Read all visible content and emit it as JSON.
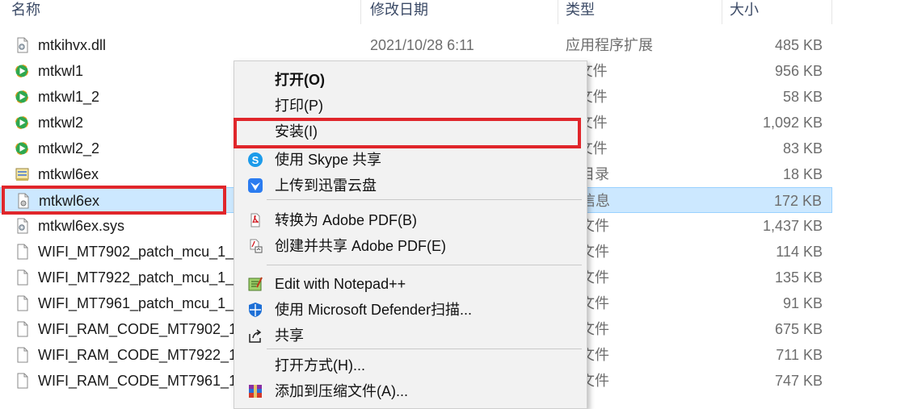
{
  "columns": {
    "name": "名称",
    "date": "修改日期",
    "type": "类型",
    "size": "大小"
  },
  "files": [
    {
      "name": "mtkihvx.dll",
      "date": "2021/10/28 6:11",
      "type": "应用程序扩展",
      "size": "485 KB",
      "icon": "dll-file-icon"
    },
    {
      "name": "mtkwl1",
      "date": "",
      "type": "T 文件",
      "size": "956 KB",
      "icon": "media-file-icon"
    },
    {
      "name": "mtkwl1_2",
      "date": "",
      "type": "T 文件",
      "size": "58 KB",
      "icon": "media-file-icon"
    },
    {
      "name": "mtkwl2",
      "date": "",
      "type": "T 文件",
      "size": "1,092 KB",
      "icon": "media-file-icon"
    },
    {
      "name": "mtkwl2_2",
      "date": "",
      "type": "T 文件",
      "size": "83 KB",
      "icon": "media-file-icon"
    },
    {
      "name": "mtkwl6ex",
      "date": "",
      "type": "全目录",
      "size": "18 KB",
      "icon": "catalog-file-icon"
    },
    {
      "name": "mtkwl6ex",
      "date": "",
      "type": "装信息",
      "size": "172 KB",
      "icon": "inf-file-icon",
      "selected": true
    },
    {
      "name": "mtkwl6ex.sys",
      "date": "",
      "type": "统文件",
      "size": "1,437 KB",
      "icon": "sys-file-icon"
    },
    {
      "name": "WIFI_MT7902_patch_mcu_1_",
      "date": "",
      "type": "N 文件",
      "size": "114 KB",
      "icon": "blank-file-icon"
    },
    {
      "name": "WIFI_MT7922_patch_mcu_1_",
      "date": "",
      "type": "N 文件",
      "size": "135 KB",
      "icon": "blank-file-icon"
    },
    {
      "name": "WIFI_MT7961_patch_mcu_1_",
      "date": "",
      "type": "N 文件",
      "size": "91 KB",
      "icon": "blank-file-icon"
    },
    {
      "name": "WIFI_RAM_CODE_MT7902_1",
      "date": "",
      "type": "N 文件",
      "size": "675 KB",
      "icon": "blank-file-icon"
    },
    {
      "name": "WIFI_RAM_CODE_MT7922_1",
      "date": "",
      "type": "N 文件",
      "size": "711 KB",
      "icon": "blank-file-icon"
    },
    {
      "name": "WIFI_RAM_CODE_MT7961_1",
      "date": "",
      "type": "N 文件",
      "size": "747 KB",
      "icon": "blank-file-icon"
    }
  ],
  "context_menu": {
    "items": [
      {
        "label": "打开(O)",
        "bold": true,
        "icon": ""
      },
      {
        "label": "打印(P)",
        "icon": ""
      },
      {
        "label": "安装(I)",
        "icon": ""
      },
      {
        "label": "使用 Skype 共享",
        "icon": "skype-icon"
      },
      {
        "label": "上传到迅雷云盘",
        "icon": "xunlei-cloud-icon"
      },
      {
        "label": "转换为 Adobe PDF(B)",
        "icon": "adobe-pdf-icon"
      },
      {
        "label": "创建并共享 Adobe PDF(E)",
        "icon": "adobe-pdf-share-icon"
      },
      {
        "label": "Edit with Notepad++",
        "icon": "notepad-plus-plus-icon"
      },
      {
        "label": "使用 Microsoft Defender扫描...",
        "icon": "defender-shield-icon"
      },
      {
        "label": "共享",
        "icon": "share-icon"
      },
      {
        "label": "打开方式(H)...",
        "icon": ""
      },
      {
        "label": "添加到压缩文件(A)...",
        "icon": "winrar-icon"
      }
    ]
  },
  "colors": {
    "highlight_box": "#e0262b",
    "selection": "#cce8ff",
    "header_text": "#3b4a66"
  }
}
